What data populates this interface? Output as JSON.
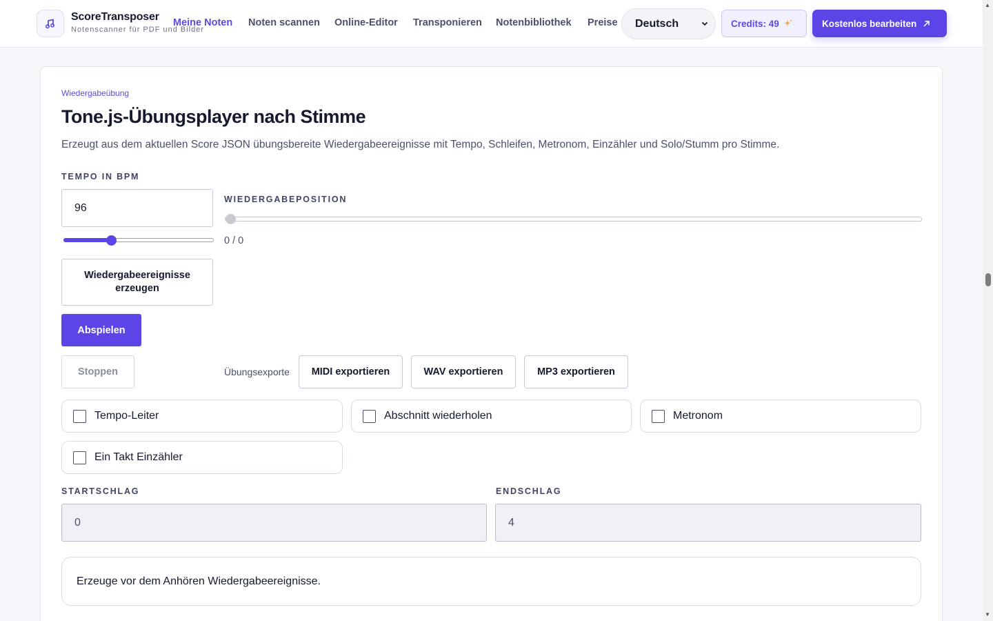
{
  "header": {
    "brand_name": "ScoreTransposer",
    "brand_sub": "Notenscanner für PDF und Bilder",
    "nav": [
      "Meine Noten",
      "Noten scannen",
      "Online-Editor",
      "Transponieren",
      "Notenbibliothek",
      "Preise"
    ],
    "language": "Deutsch",
    "credits": "Credits: 49",
    "cta": "Kostenlos bearbeiten"
  },
  "section": {
    "eyebrow": "Wiedergabeübung",
    "title": "Tone.js-Übungsplayer nach Stimme",
    "description": "Erzeugt aus dem aktuellen Score JSON übungsbereite Wiedergabeereignisse mit Tempo, Schleifen, Metronom, Einzähler und Solo/Stumm pro Stimme."
  },
  "controls": {
    "tempo_label": "TEMPO IN BPM",
    "tempo_value": "96",
    "position_label": "WIEDERGABEPOSITION",
    "position_readout": "0 / 0",
    "generate_button": "Wiedergabeereignisse erzeugen",
    "play_button": "Abspielen",
    "stop_button": "Stoppen",
    "export_label": "Übungsexporte",
    "export_midi": "MIDI exportieren",
    "export_wav": "WAV exportieren",
    "export_mp3": "MP3 exportieren"
  },
  "options": [
    {
      "label": "Tempo-Leiter",
      "checked": false
    },
    {
      "label": "Abschnitt wiederholen",
      "checked": false
    },
    {
      "label": "Metronom",
      "checked": false
    },
    {
      "label": "Ein Takt Einzähler",
      "checked": false
    }
  ],
  "range": {
    "start_label": "STARTSCHLAG",
    "start_value": "0",
    "end_label": "ENDSCHLAG",
    "end_value": "4"
  },
  "status_message": "Erzeuge vor dem Anhören Wiedergabeereignisse.",
  "colors": {
    "accent": "#5b45e6",
    "text": "#151a2e",
    "muted": "#4b5168"
  }
}
